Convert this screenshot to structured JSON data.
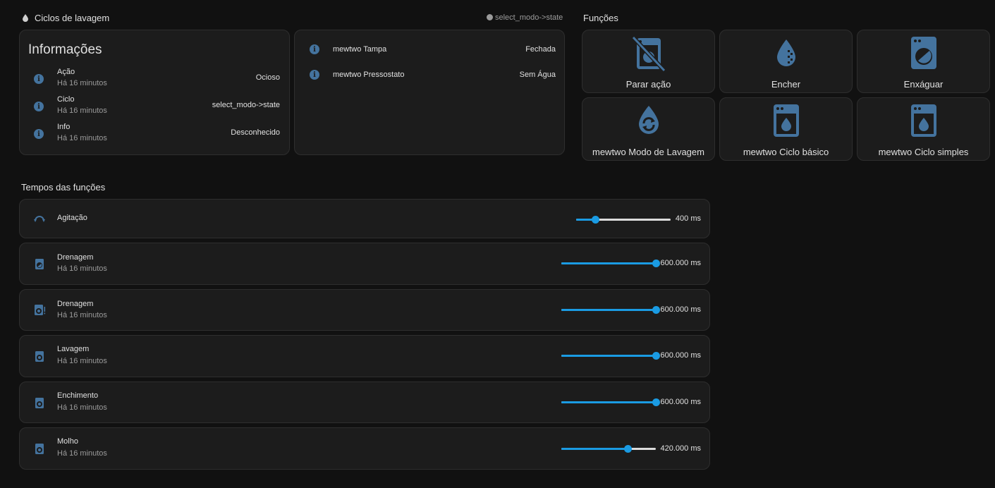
{
  "header": {
    "title": "Ciclos de lavagem",
    "select_hint": "select_modo->state"
  },
  "informacoes": {
    "title": "Informações",
    "items": [
      {
        "name": "Ação",
        "time": "Há 16 minutos",
        "value": "Ocioso"
      },
      {
        "name": "Ciclo",
        "time": "Há 16 minutos",
        "value": "select_modo->state"
      },
      {
        "name": "Info",
        "time": "Há 16 minutos",
        "value": "Desconhecido"
      }
    ]
  },
  "sensors": {
    "items": [
      {
        "name": "mewtwo Tampa",
        "value": "Fechada"
      },
      {
        "name": "mewtwo Pressostato",
        "value": "Sem Água"
      }
    ]
  },
  "funcoes": {
    "title": "Funções",
    "buttons": [
      {
        "label": "Parar ação",
        "icon": "washing-machine-off-icon"
      },
      {
        "label": "Encher",
        "icon": "water-opacity-icon"
      },
      {
        "label": "Enxáguar",
        "icon": "washing-machine-spin-icon"
      },
      {
        "label": "mewtwo Modo de Lavagem",
        "icon": "water-sync-icon"
      },
      {
        "label": "mewtwo Ciclo básico",
        "icon": "washing-machine-water-icon"
      },
      {
        "label": "mewtwo Ciclo simples",
        "icon": "washing-machine-water-icon"
      }
    ]
  },
  "tempos": {
    "title": "Tempos das funções",
    "rows": [
      {
        "name": "Agitação",
        "time": "",
        "value": "400 ms",
        "fraction": 0.2,
        "icon": "rotate-icon"
      },
      {
        "name": "Drenagem",
        "time": "Há 16 minutos",
        "value": "600.000 ms",
        "fraction": 1.0,
        "icon": "washing-machine-drain-icon"
      },
      {
        "name": "Drenagem",
        "time": "Há 16 minutos",
        "value": "600.000 ms",
        "fraction": 1.0,
        "icon": "washing-machine-alert-icon"
      },
      {
        "name": "Lavagem",
        "time": "Há 16 minutos",
        "value": "600.000 ms",
        "fraction": 1.0,
        "icon": "washing-machine-icon"
      },
      {
        "name": "Enchimento",
        "time": "Há 16 minutos",
        "value": "600.000 ms",
        "fraction": 1.0,
        "icon": "washing-machine-icon"
      },
      {
        "name": "Molho",
        "time": "Há 16 minutos",
        "value": "420.000 ms",
        "fraction": 0.7,
        "icon": "washing-machine-icon"
      }
    ]
  },
  "colors": {
    "background": "#111111",
    "card": "#1c1c1c",
    "icon_blue": "#44739e",
    "slider_blue": "#1a9be3"
  }
}
